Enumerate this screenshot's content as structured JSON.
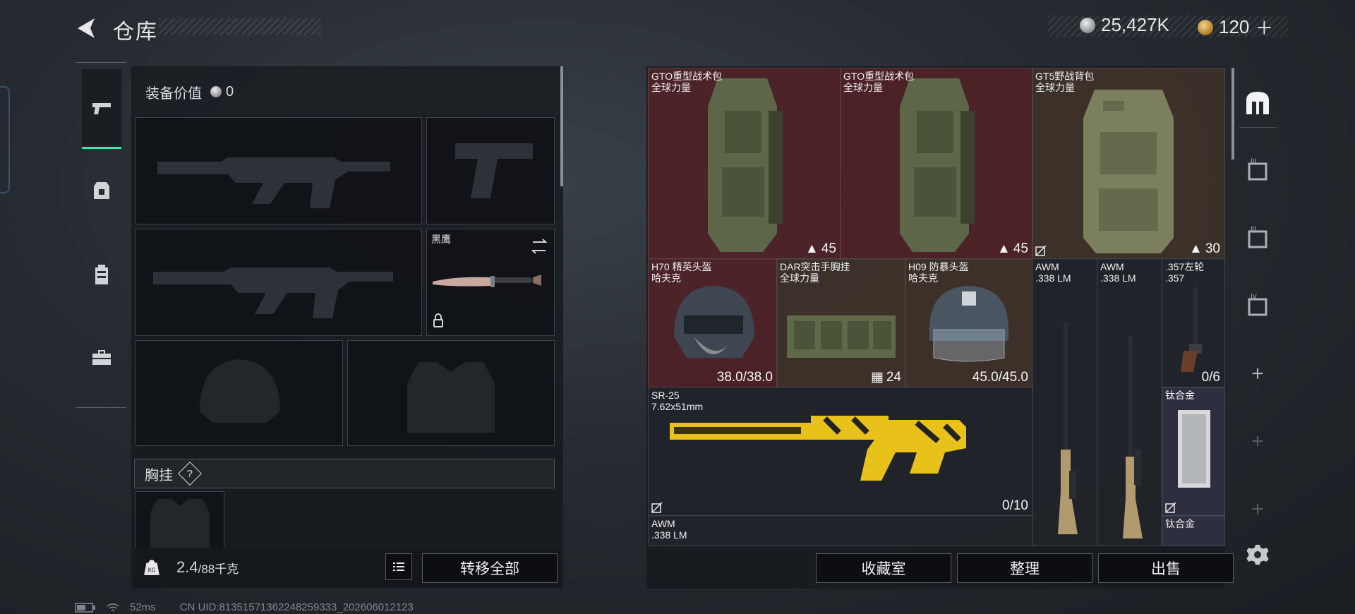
{
  "header": {
    "title": "仓库",
    "currency_silver": "25,427K",
    "currency_gold": "120",
    "currency_gold_plus": "＋"
  },
  "tabs": [
    {
      "name": "weapons",
      "icon": "pistol-icon",
      "active": true
    },
    {
      "name": "armor",
      "icon": "armor-icon",
      "active": false
    },
    {
      "name": "backpack",
      "icon": "backpack-icon",
      "active": false
    },
    {
      "name": "toolbox",
      "icon": "toolbox-icon",
      "active": false
    }
  ],
  "equipment": {
    "value_label": "装备价值",
    "value": "0",
    "melee_label": "黑鹰",
    "chest_label": "胸挂",
    "help": "?",
    "weight": "2.4",
    "weight_max": "/88千克",
    "transfer_all": "转移全部"
  },
  "items": {
    "gto1": {
      "name": "GTO重型战术包",
      "brand": "全球力量",
      "count": "45"
    },
    "gto2": {
      "name": "GTO重型战术包",
      "brand": "全球力量",
      "count": "45"
    },
    "gt5": {
      "name": "GT5野战背包",
      "brand": "全球力量",
      "count": "30"
    },
    "h70": {
      "name": "H70 精英头盔",
      "brand": "哈夫克",
      "durability": "38.0/38.0"
    },
    "dar": {
      "name": "DAR突击手胸挂",
      "brand": "全球力量",
      "count": "24"
    },
    "h09": {
      "name": "H09 防暴头盔",
      "brand": "哈夫克",
      "durability": "45.0/45.0"
    },
    "awm1": {
      "name": "AWM",
      "ammo": ".338 LM"
    },
    "awm2": {
      "name": "AWM",
      "ammo": ".338 LM"
    },
    "revolver": {
      "name": ".357左轮",
      "ammo": ".357",
      "mag": "0/6"
    },
    "sr25": {
      "name": "SR-25",
      "ammo": "7.62x51mm",
      "mag": "0/10"
    },
    "titanium1": {
      "name": "钛合金"
    },
    "titanium2": {
      "name": "钛合金"
    },
    "awm3": {
      "name": "AWM",
      "ammo": ".338 LM"
    }
  },
  "actions": {
    "collection": "收藏室",
    "sort": "整理",
    "sell": "出售"
  },
  "rail": {
    "levels": [
      "III",
      "III",
      "IV"
    ],
    "plus": "+"
  },
  "status": {
    "ping": "52ms",
    "uid": "CN UID:81351571362248259333_202606012123"
  },
  "colors": {
    "accent": "#3fe0a8",
    "red_rarity": "#60242a",
    "gold_rarity": "#4a382c",
    "yellow_skin": "#e8c21a"
  }
}
